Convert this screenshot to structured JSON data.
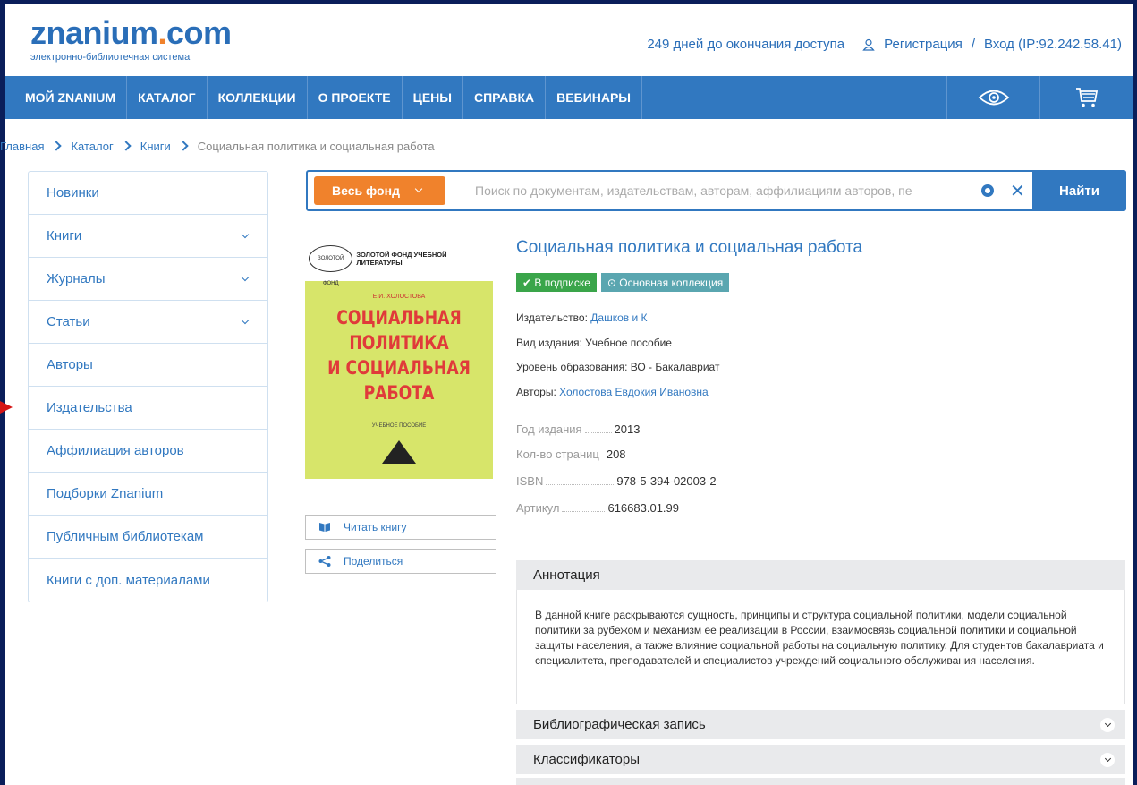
{
  "header": {
    "logo_text_1": "znanium",
    "logo_dot": ".",
    "logo_text_2": "com",
    "logo_subtitle": "электронно-библиотечная система",
    "days_left": "249 дней до окончания доступа",
    "register": "Регистрация",
    "separator": "/",
    "login": "Вход (IP:92.242.58.41)"
  },
  "nav": {
    "items": [
      "МОЙ ZNANIUM",
      "КАТАЛОГ",
      "КОЛЛЕКЦИИ",
      "О ПРОЕКТЕ",
      "ЦЕНЫ",
      "СПРАВКА",
      "ВЕБИНАРЫ"
    ]
  },
  "breadcrumb": {
    "items": [
      "Главная",
      "Каталог",
      "Книги"
    ],
    "current": "Социальная политика и социальная работа"
  },
  "sidebar": {
    "items": [
      "Новинки",
      "Книги",
      "Журналы",
      "Статьи",
      "Авторы",
      "Издательства",
      "Аффилиация авторов",
      "Подборки Znanium",
      "Публичным библиотекам",
      "Книги с доп. материалами"
    ]
  },
  "search": {
    "scope_label": "Весь фонд",
    "placeholder": "Поиск по документам, издательствам, авторам, аффилиациям авторов, пе",
    "submit_label": "Найти"
  },
  "cover": {
    "seal": "ЗОЛОТОЙ ФОНД",
    "series": "ЗОЛОТОЙ ФОНД УЧЕБНОЙ ЛИТЕРАТУРЫ",
    "author": "Е.И. ХОЛОСТОВА",
    "title_1": "СОЦИАЛЬНАЯ ПОЛИТИКА",
    "title_2": "И СОЦИАЛЬНАЯ РАБОТА",
    "type": "УЧЕБНОЕ ПОСОБИЕ"
  },
  "actions": {
    "read": "Читать книгу",
    "share": "Поделиться"
  },
  "book": {
    "title": "Социальная политика и социальная работа",
    "badge_subscription": "✔ В подписке",
    "badge_collection": "⊙ Основная коллекция",
    "publisher_label": "Издательство:",
    "publisher": "Дашков и К",
    "edition_type": "Вид издания: Учебное пособие",
    "education_level": "Уровень образования: ВО - Бакалавриат",
    "authors_label": "Авторы:",
    "authors": "Холостова Евдокия Ивановна",
    "year_label": "Год издания",
    "year": "2013",
    "pages_label": "Кол-во страниц",
    "pages": "208",
    "isbn_label": "ISBN",
    "isbn": "978-5-394-02003-2",
    "article_label": "Артикул",
    "article": "616683.01.99"
  },
  "panels": {
    "annotation_title": "Аннотация",
    "annotation_text": "В данной книге раскрываются сущность, принципы и структура социальной политики, модели социальной политики за рубежом и механизм ее реализации в России, взаимосвязь социальной политики и социальной защиты населения, а также влияние социальной работы на социальную политику. Для студентов бакалавриата и специалитета, преподавателей и специалистов учреждений социального обслуживания населения.",
    "bibliography_title": "Библиографическая запись",
    "classifiers_title": "Классификаторы"
  },
  "colors": {
    "brand_blue": "#3178c0",
    "accent_orange": "#f0822c",
    "badge_green": "#3aa54a",
    "badge_teal": "#5aa6b0",
    "frame": "#0a1e5a",
    "arrow": "#d51515"
  },
  "icons": [
    "user-icon",
    "eye-icon",
    "cart-icon",
    "chevron-down-icon",
    "settings-gear-icon",
    "close-icon",
    "book-icon",
    "share-icon"
  ]
}
